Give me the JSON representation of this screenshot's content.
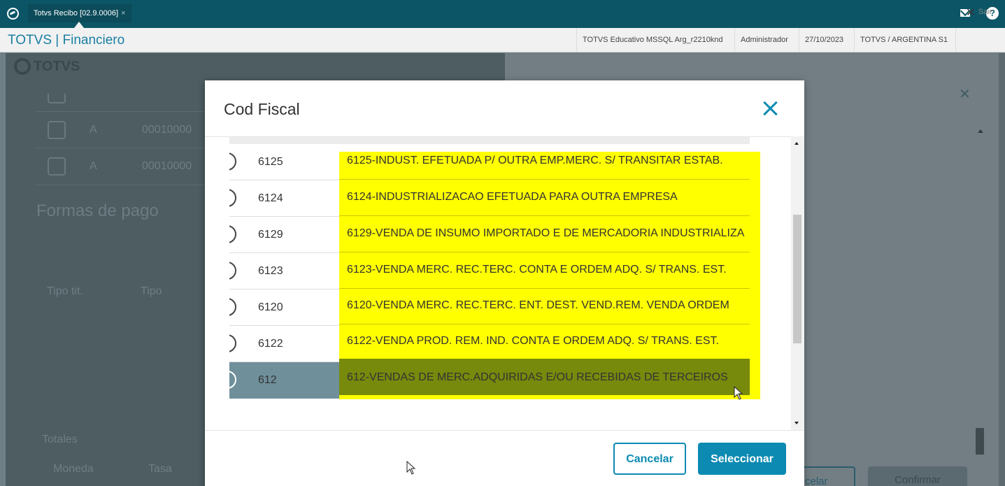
{
  "topbar": {
    "tab_title": "Totvs Recibo [02.9.0006]",
    "tab_close": "×"
  },
  "header": {
    "module": "TOTVS | Financiero",
    "environment": "TOTVS Educativo MSSQL Arg_r2210knd",
    "user": "Administrador",
    "date": "27/10/2023",
    "company": "TOTVS / ARGENTINA S1",
    "exit_label": "Sair"
  },
  "background": {
    "brand": "TOTVS",
    "rows": [
      {
        "col1": "A",
        "col2": "00010000"
      },
      {
        "col1": "A",
        "col2": "00010000"
      }
    ],
    "section_title": "Formas de pago",
    "col_tipo_tit": "Tipo tit.",
    "col_tipo": "Tipo",
    "totales": "Totales",
    "moneda": "Moneda",
    "tasa": "Tasa",
    "btn_cancelar_partial": "celar",
    "btn_confirmar": "Confirmar"
  },
  "modal": {
    "title": "Cod Fiscal",
    "rows": [
      {
        "code": "6125",
        "desc": "6125-INDUST. EFETUADA P/ OUTRA EMP.MERC. S/ TRANSITAR ESTAB."
      },
      {
        "code": "6124",
        "desc": "6124-INDUSTRIALIZACAO EFETUADA PARA OUTRA EMPRESA"
      },
      {
        "code": "6129",
        "desc": "6129-VENDA DE INSUMO IMPORTADO E DE MERCADORIA INDUSTRIALIZA"
      },
      {
        "code": "6123",
        "desc": "6123-VENDA MERC. REC.TERC. CONTA E ORDEM ADQ. S/ TRANS. EST."
      },
      {
        "code": "6120",
        "desc": "6120-VENDA MERC. REC.TERC. ENT. DEST. VEND.REM. VENDA ORDEM"
      },
      {
        "code": "6122",
        "desc": "6122-VENDA PROD. REM. IND. CONTA E ORDEM ADQ. S/ TRANS. EST."
      },
      {
        "code": "612",
        "desc": "612-VENDAS DE MERC.ADQUIRIDAS E/OU RECEBIDAS DE TERCEIROS"
      }
    ],
    "cancel_label": "Cancelar",
    "select_label": "Seleccionar"
  },
  "colors": {
    "accent": "#0c8ab2",
    "topbar": "#0b5566",
    "highlight": "#ffff00",
    "selected_row": "#6f8f9b"
  }
}
